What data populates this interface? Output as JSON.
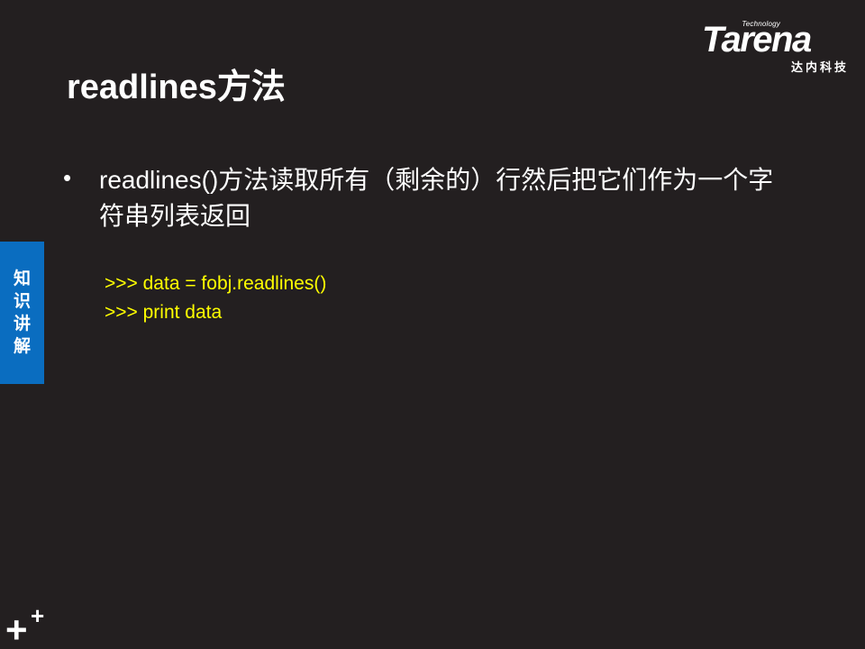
{
  "logo": {
    "technology": "Technology",
    "wordmark": "Tarena",
    "chinese": "达内科技"
  },
  "title": "readlines方法",
  "bullets": [
    {
      "symbol": "•",
      "text": "readlines()方法读取所有（剩余的）行然后把它们作为一个字符串列表返回"
    }
  ],
  "code": {
    "lines": [
      ">>> data = fobj.readlines()",
      ">>> print data"
    ]
  },
  "side_tab": {
    "label": "知识讲解"
  },
  "colors": {
    "background": "#231f20",
    "code": "#ffff00",
    "tab": "#0a6dc0"
  },
  "icons": {
    "corner_mark": "plus-plus-icon"
  }
}
